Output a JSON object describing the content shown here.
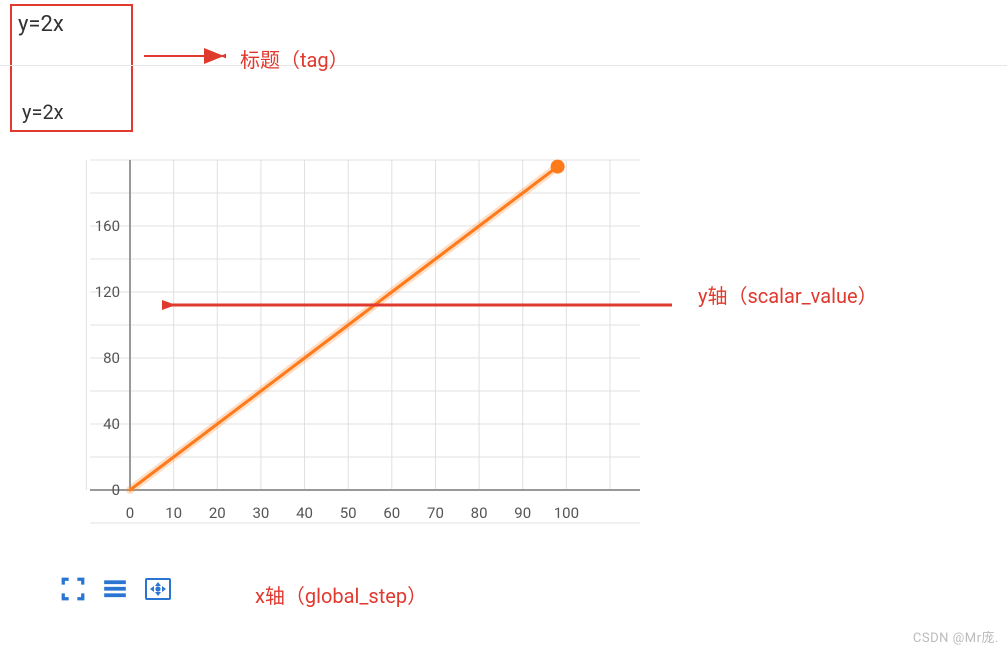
{
  "titles": {
    "main": "y=2x",
    "sub": "y=2x"
  },
  "annotations": {
    "tag": "标题（tag）",
    "yaxis": "y轴（scalar_value）",
    "xaxis": "x轴（global_step）"
  },
  "chart_data": {
    "type": "line",
    "title": "y=2x",
    "xlabel": "global_step",
    "ylabel": "scalar_value",
    "xlim": [
      0,
      110
    ],
    "ylim": [
      0,
      200
    ],
    "x_ticks": [
      0,
      10,
      20,
      30,
      40,
      50,
      60,
      70,
      80,
      90,
      100
    ],
    "y_ticks": [
      0,
      40,
      80,
      120,
      160
    ],
    "series": [
      {
        "name": "y=2x",
        "color": "#ff7a1a",
        "points": [
          [
            0,
            0
          ],
          [
            10,
            20
          ],
          [
            20,
            40
          ],
          [
            30,
            60
          ],
          [
            40,
            80
          ],
          [
            50,
            100
          ],
          [
            60,
            120
          ],
          [
            70,
            140
          ],
          [
            80,
            160
          ],
          [
            90,
            180
          ],
          [
            98,
            196
          ]
        ]
      }
    ]
  },
  "icons": {
    "fullscreen": "fullscreen-icon",
    "list": "list-icon",
    "fit": "fit-icon"
  },
  "colors": {
    "annotation": "#e0392e",
    "line": "#ff7a1a",
    "grid": "#e0e0e0",
    "axis": "#999",
    "icon": "#2a75d1"
  },
  "watermark": "CSDN @Mr庞."
}
